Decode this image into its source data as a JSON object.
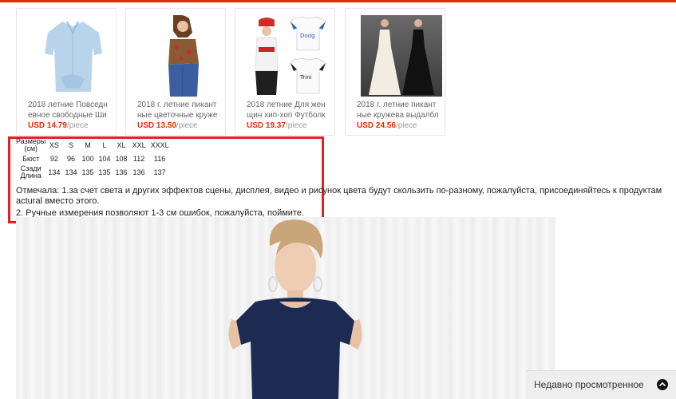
{
  "products": [
    {
      "name": "2018 летние Повседневное свободные Ши",
      "price": "USD 14.79",
      "unit": "/piece",
      "image": "light-blue-shirt"
    },
    {
      "name": "2018 г. летние пикантные цветочные круже",
      "price": "USD 13.50",
      "unit": "/piece",
      "image": "floral-lace-top"
    },
    {
      "name": "2018 летние Для женщин хип-хоп Футболк",
      "price": "USD 19.37",
      "unit": "/piece",
      "image": "hiphop-tshirt"
    },
    {
      "name": "2018 г. летние пикантные кружева выдалбл",
      "price": "USD 24.56",
      "unit": "/piece",
      "image": "lace-long-dress"
    }
  ],
  "size_table": {
    "header": [
      "Размеры (см)",
      "XS",
      "S",
      "M",
      "L",
      "XL",
      "XXL",
      "XXXL"
    ],
    "rows": [
      [
        "Бюст",
        "92",
        "96",
        "100",
        "104",
        "108",
        "112",
        "116"
      ],
      [
        "Сзади Длина",
        "134",
        "134",
        "135",
        "135",
        "136",
        "136",
        "137"
      ]
    ]
  },
  "note": {
    "line1": "Отмечала: 1.за счет света и других эффектов сцены, дисплея, видео и рисунок цвета будут скользить по-разному, пожалуйста, присоединяйтесь к продуктам actural вместо этого.",
    "line2": "2. Ручные измерения позволяют 1-3 см ошибок, пожалуйста, поймите."
  },
  "recently_viewed": {
    "label": "Недавно просмотренное",
    "icon": "chevron-up-icon"
  },
  "colors": {
    "accent": "#e62e04",
    "highlight_box": "#e62022",
    "price": "#e62e04"
  }
}
